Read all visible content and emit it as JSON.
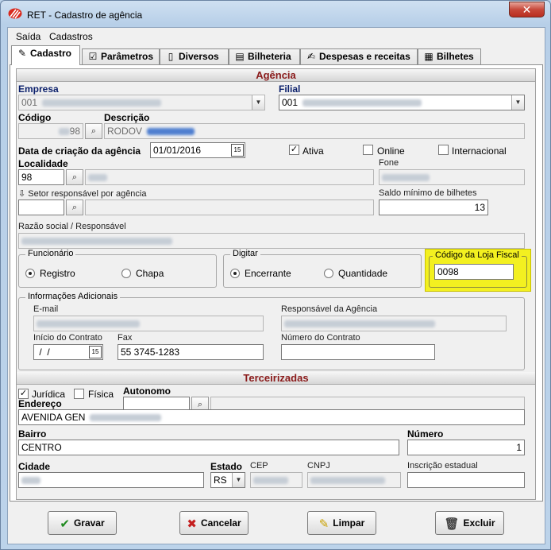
{
  "window": {
    "title": "RET - Cadastro de agência",
    "close_symbol": "✕"
  },
  "menu": [
    "Saída",
    "Cadastros"
  ],
  "tabs": [
    {
      "label": "Cadastro",
      "icon": "pencil-icon",
      "glyph": "✎"
    },
    {
      "label": "Parâmetros",
      "icon": "checkbox-icon",
      "glyph": "☑"
    },
    {
      "label": "Diversos",
      "icon": "page-icon",
      "glyph": "▯"
    },
    {
      "label": "Bilheteria",
      "icon": "document-icon",
      "glyph": "▤"
    },
    {
      "label": "Despesas e receitas",
      "icon": "edit-document-icon",
      "glyph": "✍"
    },
    {
      "label": "Bilhetes",
      "icon": "notepad-icon",
      "glyph": "▦"
    }
  ],
  "agencia": {
    "section_title": "Agência",
    "empresa_label": "Empresa",
    "empresa_value": "001",
    "filial_label": "Filial",
    "filial_value": "001",
    "codigo_label": "Código",
    "codigo_value": "98",
    "descricao_label": "Descrição",
    "descricao_value": "RODOV",
    "data_criacao_label": "Data de criação da agência",
    "data_criacao_value": "01/01/2016",
    "ativa_label": "Ativa",
    "ativa_checked": true,
    "online_label": "Online",
    "online_checked": false,
    "internacional_label": "Internacional",
    "internacional_checked": false,
    "localidade_label": "Localidade",
    "localidade_value": "98",
    "fone_label": "Fone",
    "setor_label": "Setor responsável por agência",
    "saldo_label": "Saldo mínimo de bilhetes",
    "saldo_value": "13",
    "razao_label": "Razão social / Responsável",
    "funcionario": {
      "title": "Funcionário",
      "options": [
        "Registro",
        "Chapa"
      ],
      "selected": "Registro"
    },
    "digitar": {
      "title": "Digitar",
      "options": [
        "Encerrante",
        "Quantidade"
      ],
      "selected": "Encerrante"
    },
    "loja_fiscal_label": "Código da Loja Fiscal",
    "loja_fiscal_value": "0098",
    "highlight_color": "#f3f020",
    "info_adicionais": {
      "title": "Informações Adicionais",
      "email_label": "E-mail",
      "responsavel_label": "Responsável da Agência",
      "inicio_label": "Início do Contrato",
      "inicio_value": " /  /",
      "fax_label": "Fax",
      "fax_value": "55 3745-1283",
      "numero_contrato_label": "Número do Contrato"
    }
  },
  "terceirizadas": {
    "section_title": "Terceirizadas",
    "juridica_label": "Jurídica",
    "juridica_checked": true,
    "fisica_label": "Física",
    "fisica_checked": false,
    "autonomo_label": "Autonomo",
    "endereco_label": "Endereço",
    "endereco_value": "AVENIDA GEN",
    "bairro_label": "Bairro",
    "bairro_value": "CENTRO",
    "numero_label": "Número",
    "numero_value": "1",
    "cidade_label": "Cidade",
    "estado_label": "Estado",
    "estado_value": "RS",
    "cep_label": "CEP",
    "cnpj_label": "CNPJ",
    "inscricao_label": "Inscrição estadual"
  },
  "buttons": [
    {
      "label": "Gravar",
      "icon": "check-icon",
      "glyph": "✔",
      "color": "#1f8a1f"
    },
    {
      "label": "Cancelar",
      "icon": "cancel-x-icon",
      "glyph": "✖",
      "color": "#c41e1e"
    },
    {
      "label": "Limpar",
      "icon": "eraser-icon",
      "glyph": "✎",
      "color": "#c8a000"
    },
    {
      "label": "Excluir",
      "icon": "trash-icon",
      "glyph": "🗑",
      "color": "#444444"
    }
  ],
  "glyphs": {
    "dropdown": "▼",
    "search": "⌕",
    "calendar": "15",
    "check": "✓",
    "tree": "⇩"
  }
}
